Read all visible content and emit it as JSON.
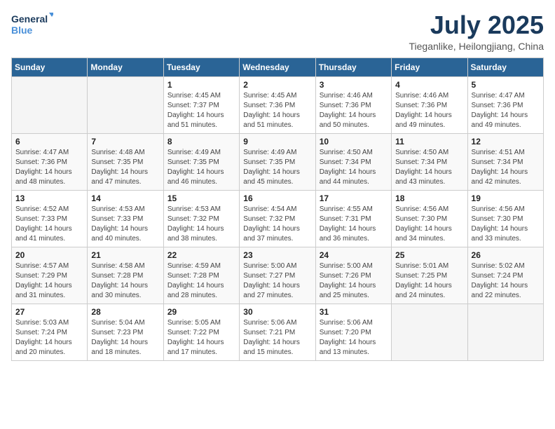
{
  "header": {
    "logo_line1": "General",
    "logo_line2": "Blue",
    "month_year": "July 2025",
    "location": "Tieganlike, Heilongjiang, China"
  },
  "weekdays": [
    "Sunday",
    "Monday",
    "Tuesday",
    "Wednesday",
    "Thursday",
    "Friday",
    "Saturday"
  ],
  "weeks": [
    [
      {
        "day": "",
        "info": ""
      },
      {
        "day": "",
        "info": ""
      },
      {
        "day": "1",
        "info": "Sunrise: 4:45 AM\nSunset: 7:37 PM\nDaylight: 14 hours and 51 minutes."
      },
      {
        "day": "2",
        "info": "Sunrise: 4:45 AM\nSunset: 7:36 PM\nDaylight: 14 hours and 51 minutes."
      },
      {
        "day": "3",
        "info": "Sunrise: 4:46 AM\nSunset: 7:36 PM\nDaylight: 14 hours and 50 minutes."
      },
      {
        "day": "4",
        "info": "Sunrise: 4:46 AM\nSunset: 7:36 PM\nDaylight: 14 hours and 49 minutes."
      },
      {
        "day": "5",
        "info": "Sunrise: 4:47 AM\nSunset: 7:36 PM\nDaylight: 14 hours and 49 minutes."
      }
    ],
    [
      {
        "day": "6",
        "info": "Sunrise: 4:47 AM\nSunset: 7:36 PM\nDaylight: 14 hours and 48 minutes."
      },
      {
        "day": "7",
        "info": "Sunrise: 4:48 AM\nSunset: 7:35 PM\nDaylight: 14 hours and 47 minutes."
      },
      {
        "day": "8",
        "info": "Sunrise: 4:49 AM\nSunset: 7:35 PM\nDaylight: 14 hours and 46 minutes."
      },
      {
        "day": "9",
        "info": "Sunrise: 4:49 AM\nSunset: 7:35 PM\nDaylight: 14 hours and 45 minutes."
      },
      {
        "day": "10",
        "info": "Sunrise: 4:50 AM\nSunset: 7:34 PM\nDaylight: 14 hours and 44 minutes."
      },
      {
        "day": "11",
        "info": "Sunrise: 4:50 AM\nSunset: 7:34 PM\nDaylight: 14 hours and 43 minutes."
      },
      {
        "day": "12",
        "info": "Sunrise: 4:51 AM\nSunset: 7:34 PM\nDaylight: 14 hours and 42 minutes."
      }
    ],
    [
      {
        "day": "13",
        "info": "Sunrise: 4:52 AM\nSunset: 7:33 PM\nDaylight: 14 hours and 41 minutes."
      },
      {
        "day": "14",
        "info": "Sunrise: 4:53 AM\nSunset: 7:33 PM\nDaylight: 14 hours and 40 minutes."
      },
      {
        "day": "15",
        "info": "Sunrise: 4:53 AM\nSunset: 7:32 PM\nDaylight: 14 hours and 38 minutes."
      },
      {
        "day": "16",
        "info": "Sunrise: 4:54 AM\nSunset: 7:32 PM\nDaylight: 14 hours and 37 minutes."
      },
      {
        "day": "17",
        "info": "Sunrise: 4:55 AM\nSunset: 7:31 PM\nDaylight: 14 hours and 36 minutes."
      },
      {
        "day": "18",
        "info": "Sunrise: 4:56 AM\nSunset: 7:30 PM\nDaylight: 14 hours and 34 minutes."
      },
      {
        "day": "19",
        "info": "Sunrise: 4:56 AM\nSunset: 7:30 PM\nDaylight: 14 hours and 33 minutes."
      }
    ],
    [
      {
        "day": "20",
        "info": "Sunrise: 4:57 AM\nSunset: 7:29 PM\nDaylight: 14 hours and 31 minutes."
      },
      {
        "day": "21",
        "info": "Sunrise: 4:58 AM\nSunset: 7:28 PM\nDaylight: 14 hours and 30 minutes."
      },
      {
        "day": "22",
        "info": "Sunrise: 4:59 AM\nSunset: 7:28 PM\nDaylight: 14 hours and 28 minutes."
      },
      {
        "day": "23",
        "info": "Sunrise: 5:00 AM\nSunset: 7:27 PM\nDaylight: 14 hours and 27 minutes."
      },
      {
        "day": "24",
        "info": "Sunrise: 5:00 AM\nSunset: 7:26 PM\nDaylight: 14 hours and 25 minutes."
      },
      {
        "day": "25",
        "info": "Sunrise: 5:01 AM\nSunset: 7:25 PM\nDaylight: 14 hours and 24 minutes."
      },
      {
        "day": "26",
        "info": "Sunrise: 5:02 AM\nSunset: 7:24 PM\nDaylight: 14 hours and 22 minutes."
      }
    ],
    [
      {
        "day": "27",
        "info": "Sunrise: 5:03 AM\nSunset: 7:24 PM\nDaylight: 14 hours and 20 minutes."
      },
      {
        "day": "28",
        "info": "Sunrise: 5:04 AM\nSunset: 7:23 PM\nDaylight: 14 hours and 18 minutes."
      },
      {
        "day": "29",
        "info": "Sunrise: 5:05 AM\nSunset: 7:22 PM\nDaylight: 14 hours and 17 minutes."
      },
      {
        "day": "30",
        "info": "Sunrise: 5:06 AM\nSunset: 7:21 PM\nDaylight: 14 hours and 15 minutes."
      },
      {
        "day": "31",
        "info": "Sunrise: 5:06 AM\nSunset: 7:20 PM\nDaylight: 14 hours and 13 minutes."
      },
      {
        "day": "",
        "info": ""
      },
      {
        "day": "",
        "info": ""
      }
    ]
  ]
}
